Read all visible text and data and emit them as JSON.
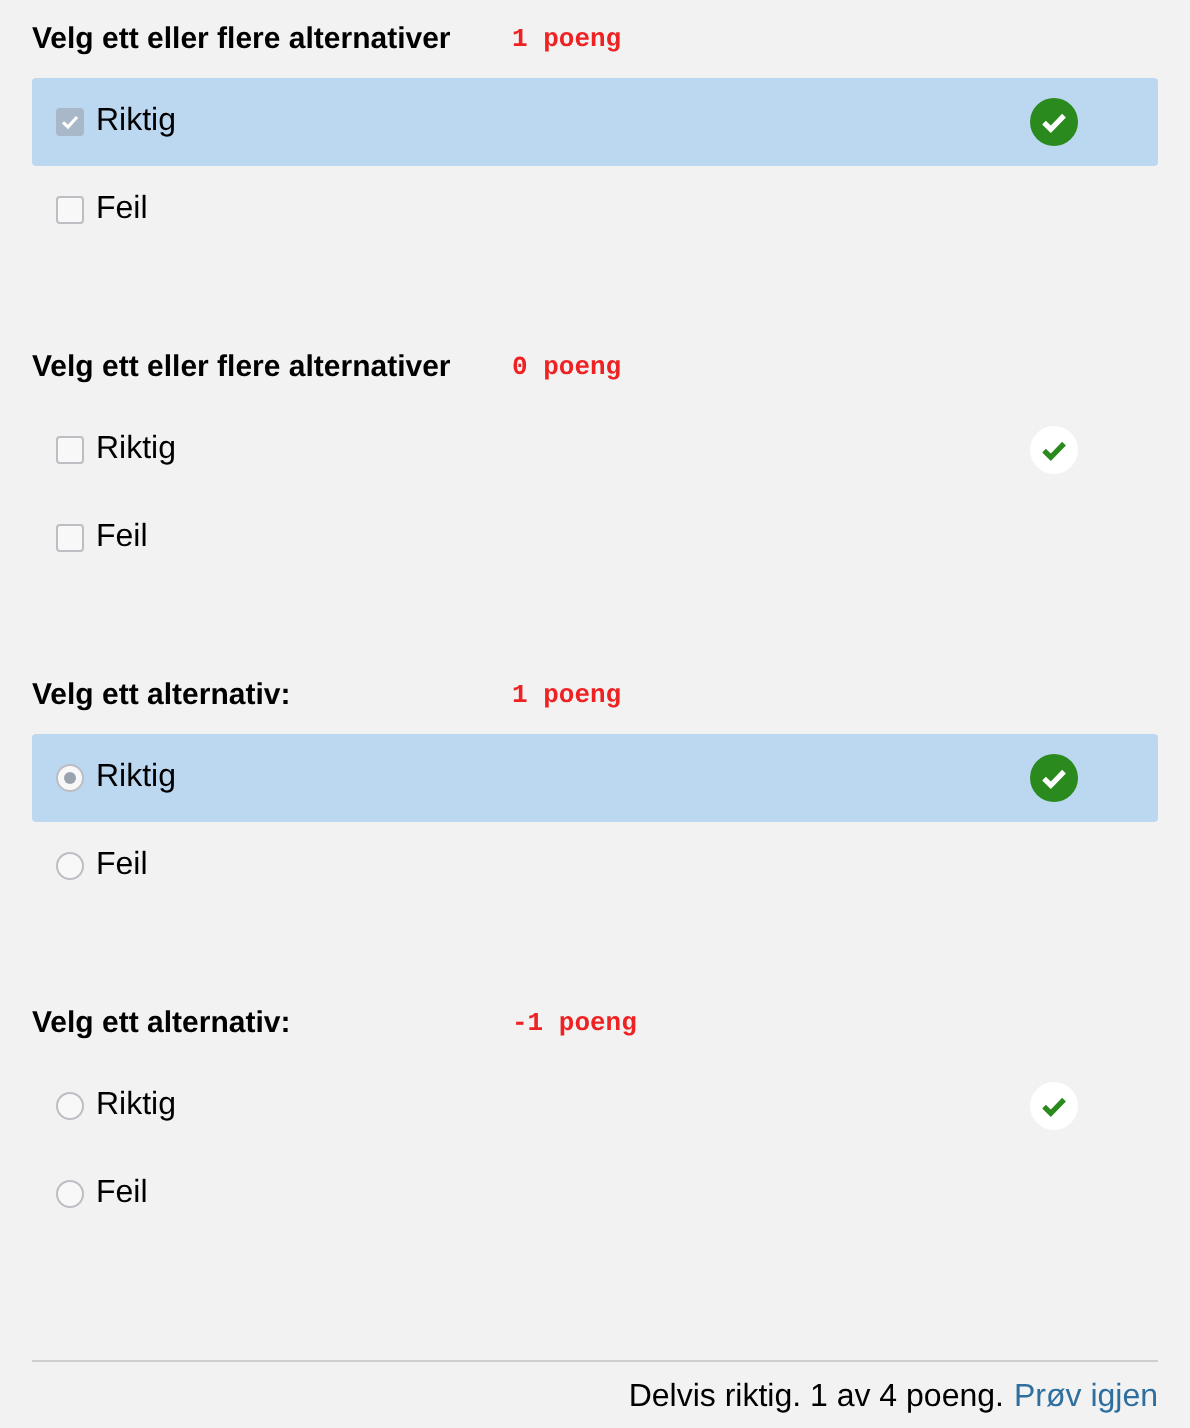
{
  "questions": [
    {
      "kind": "checkbox",
      "title": "Velg ett eller flere alternativer",
      "points": "1 poeng",
      "options": [
        {
          "label": "Riktig",
          "selected": true,
          "correct": true
        },
        {
          "label": "Feil",
          "selected": false,
          "correct": false
        }
      ]
    },
    {
      "kind": "checkbox",
      "title": "Velg ett eller flere alternativer",
      "points": "0 poeng",
      "options": [
        {
          "label": "Riktig",
          "selected": false,
          "correct": true
        },
        {
          "label": "Feil",
          "selected": false,
          "correct": false
        }
      ]
    },
    {
      "kind": "radio",
      "title": "Velg ett alternativ:",
      "points": "1 poeng",
      "options": [
        {
          "label": "Riktig",
          "selected": true,
          "correct": true
        },
        {
          "label": "Feil",
          "selected": false,
          "correct": false
        }
      ]
    },
    {
      "kind": "radio",
      "title": "Velg ett alternativ:",
      "points": "-1 poeng",
      "options": [
        {
          "label": "Riktig",
          "selected": false,
          "correct": true
        },
        {
          "label": "Feil",
          "selected": false,
          "correct": false
        }
      ]
    }
  ],
  "footer": {
    "summary": "Delvis riktig. 1 av 4 poeng.",
    "link": "Prøv igjen"
  }
}
